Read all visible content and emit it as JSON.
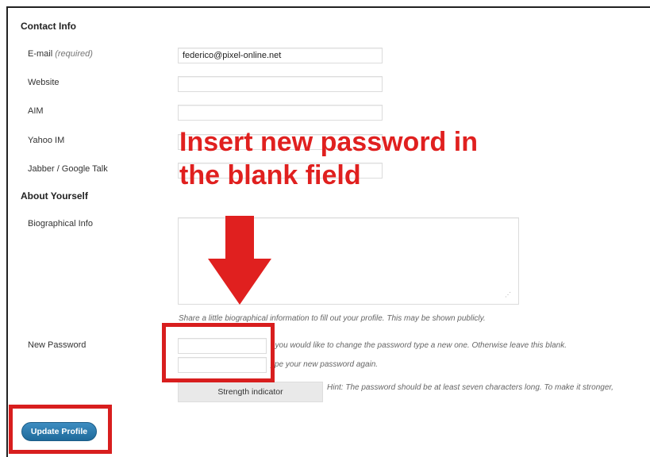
{
  "sections": {
    "contact": "Contact Info",
    "about": "About Yourself"
  },
  "fields": {
    "email": {
      "label": "E-mail",
      "required": "(required)",
      "value": "federico@pixel-online.net"
    },
    "website": {
      "label": "Website",
      "value": ""
    },
    "aim": {
      "label": "AIM",
      "value": ""
    },
    "yahoo": {
      "label": "Yahoo IM",
      "value": ""
    },
    "jabber": {
      "label": "Jabber / Google Talk",
      "value": ""
    },
    "bio": {
      "label": "Biographical Info",
      "description": "Share a little biographical information to fill out your profile. This may be shown publicly."
    }
  },
  "password": {
    "label": "New Password",
    "hint1": "f you would like to change the password type a new one. Otherwise leave this blank.",
    "hint2": "ype your new password again.",
    "strength": "Strength indicator",
    "hint3": "Hint: The password should be at least seven characters long. To make it stronger,"
  },
  "actions": {
    "update": "Update Profile"
  },
  "annotation": {
    "line1": "Insert new password in",
    "line2": "the blank field",
    "color": "#e0201f"
  }
}
